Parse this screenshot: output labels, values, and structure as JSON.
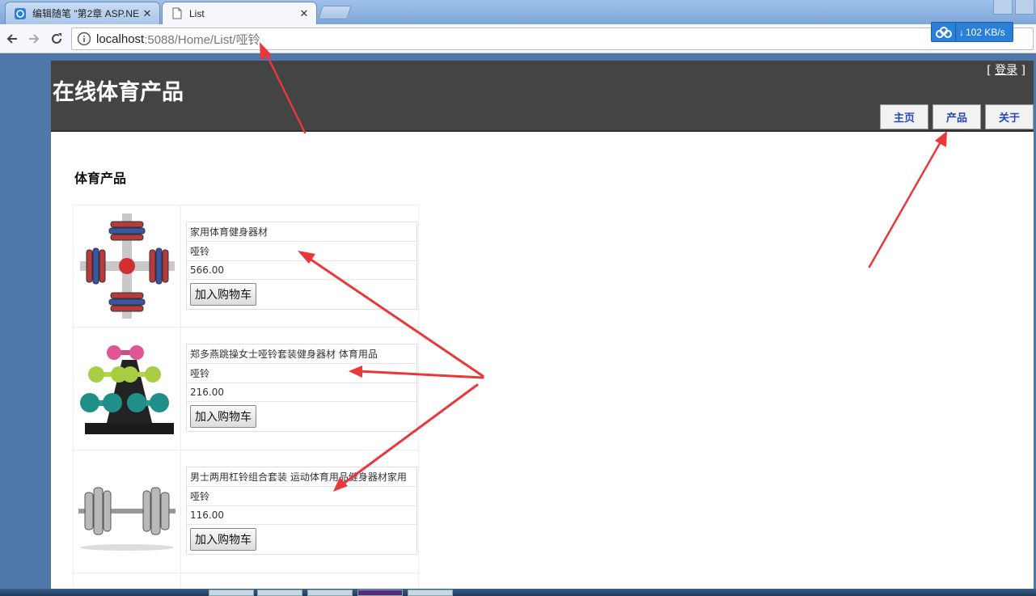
{
  "browser": {
    "tabs": [
      {
        "title": "编辑随笔 \"第2章 ASP.NE",
        "active": false
      },
      {
        "title": "List",
        "active": true
      }
    ],
    "address": {
      "host": "localhost",
      "path": ":5088/Home/List/哑铃"
    },
    "download_speed": "102 KB/s"
  },
  "header": {
    "site_title": "在线体育产品",
    "login_open": "[",
    "login_link": "登录",
    "login_close": "]",
    "menu": [
      "主页",
      "产品",
      "关于"
    ]
  },
  "section_title": "体育产品",
  "products": [
    {
      "name": "家用体育健身器材",
      "category": "哑铃",
      "price": "566.00",
      "button": "加入购物车"
    },
    {
      "name": "郑多燕跳操女士哑铃套装健身器材 体育用品",
      "category": "哑铃",
      "price": "216.00",
      "button": "加入购物车"
    },
    {
      "name": "男士两用杠铃组合套装 运动体育用品健身器材家用",
      "category": "哑铃",
      "price": "116.00",
      "button": "加入购物车"
    }
  ],
  "colors": {
    "header_bg": "#444444",
    "menu_text": "#2848b8",
    "annotation_arrow": "#e8383a",
    "desktop_bg": "#4f77a8"
  }
}
